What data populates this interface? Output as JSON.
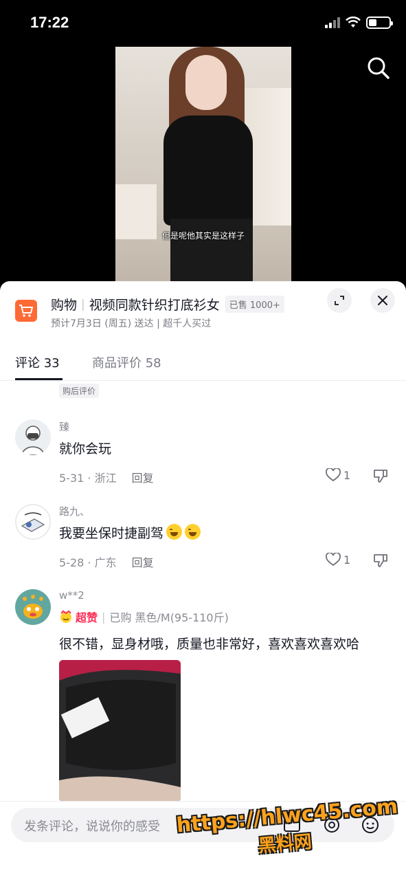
{
  "status_bar": {
    "time": "17:22"
  },
  "video": {
    "caption": "但是呢他其实是这样子"
  },
  "product": {
    "category": "购物",
    "title": "视频同款针织打底衫女",
    "sold": "已售 1000+",
    "delivery": "预计7月3日 (周五) 送达 | 超千人买过",
    "accent_color": "#fe6a35"
  },
  "tabs": [
    {
      "label": "评论 33",
      "active": true
    },
    {
      "label": "商品评价 58",
      "active": false
    }
  ],
  "comments": {
    "top_tag": "购后评价",
    "items": [
      {
        "name": "臻",
        "text": "就你会玩",
        "date_location": "5-31 · 浙江",
        "reply": "回复",
        "likes": "1"
      },
      {
        "name": "路九、",
        "text": "我要坐保时捷副驾",
        "date_location": "5-28 · 广东",
        "reply": "回复",
        "likes": "1"
      },
      {
        "name": "w**2",
        "badge": "超赞",
        "purchase_info": "已购 黑色/M(95-110斤)",
        "text": "很不错，显身材哦，质量也非常好，喜欢喜欢喜欢哈"
      }
    ]
  },
  "input": {
    "placeholder": "发条评论，说说你的感受"
  },
  "watermark": {
    "url": "https://hlwc45.com",
    "name": "黑料网"
  }
}
